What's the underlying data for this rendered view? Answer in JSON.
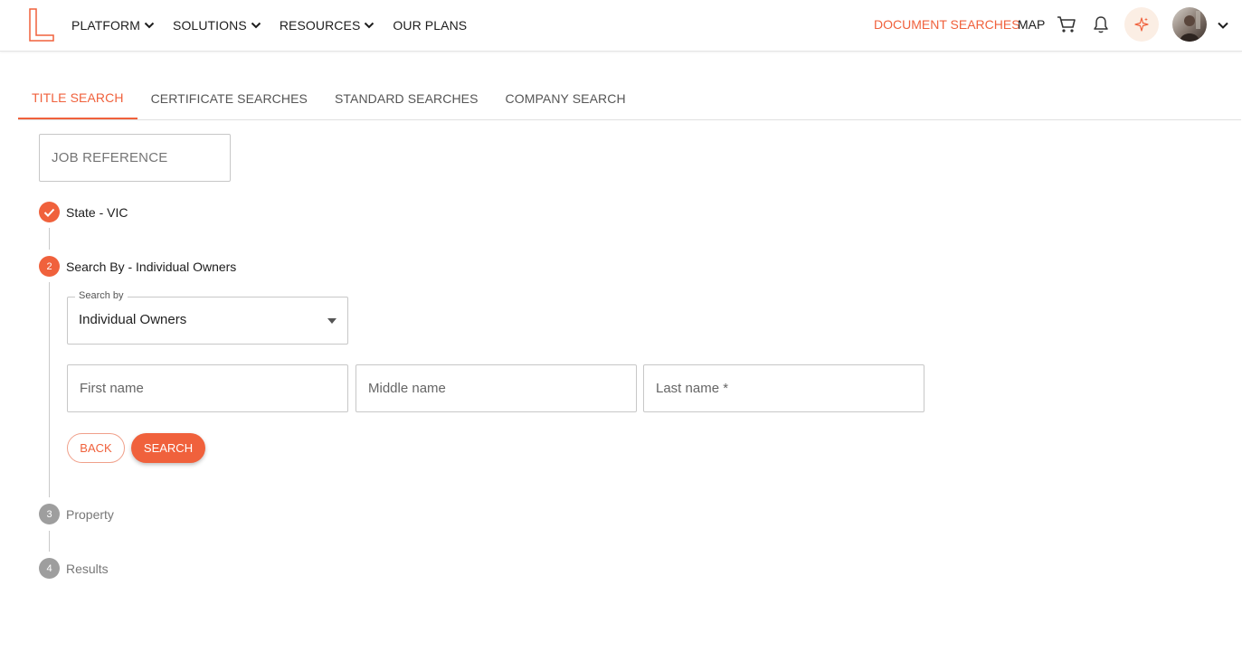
{
  "header": {
    "nav": [
      {
        "label": "PLATFORM",
        "has_dropdown": true
      },
      {
        "label": "SOLUTIONS",
        "has_dropdown": true
      },
      {
        "label": "RESOURCES",
        "has_dropdown": true
      },
      {
        "label": "OUR PLANS",
        "has_dropdown": false
      }
    ],
    "document_searches": "DOCUMENT SEARCHES",
    "map": "MAP",
    "icons": [
      "logo-icon",
      "cart-icon",
      "bell-icon",
      "sparkle-icon",
      "avatar",
      "chevron-down-icon"
    ],
    "accent_color": "#f0613c"
  },
  "tabs": [
    {
      "label": "TITLE SEARCH",
      "active": true
    },
    {
      "label": "CERTIFICATE SEARCHES",
      "active": false
    },
    {
      "label": "STANDARD SEARCHES",
      "active": false
    },
    {
      "label": "COMPANY SEARCH",
      "active": false
    }
  ],
  "job_reference": {
    "placeholder": "JOB REFERENCE"
  },
  "steps": [
    {
      "number": "",
      "label": "State - VIC",
      "status": "done"
    },
    {
      "number": "2",
      "label": "Search By - Individual Owners",
      "status": "active"
    },
    {
      "number": "3",
      "label": "Property",
      "status": "pending"
    },
    {
      "number": "4",
      "label": "Results",
      "status": "pending"
    }
  ],
  "search_by": {
    "legend": "Search by",
    "value": "Individual Owners"
  },
  "fields": {
    "first_name": "First name",
    "middle_name": "Middle name",
    "last_name": "Last name *"
  },
  "buttons": {
    "back": "BACK",
    "search": "SEARCH"
  }
}
